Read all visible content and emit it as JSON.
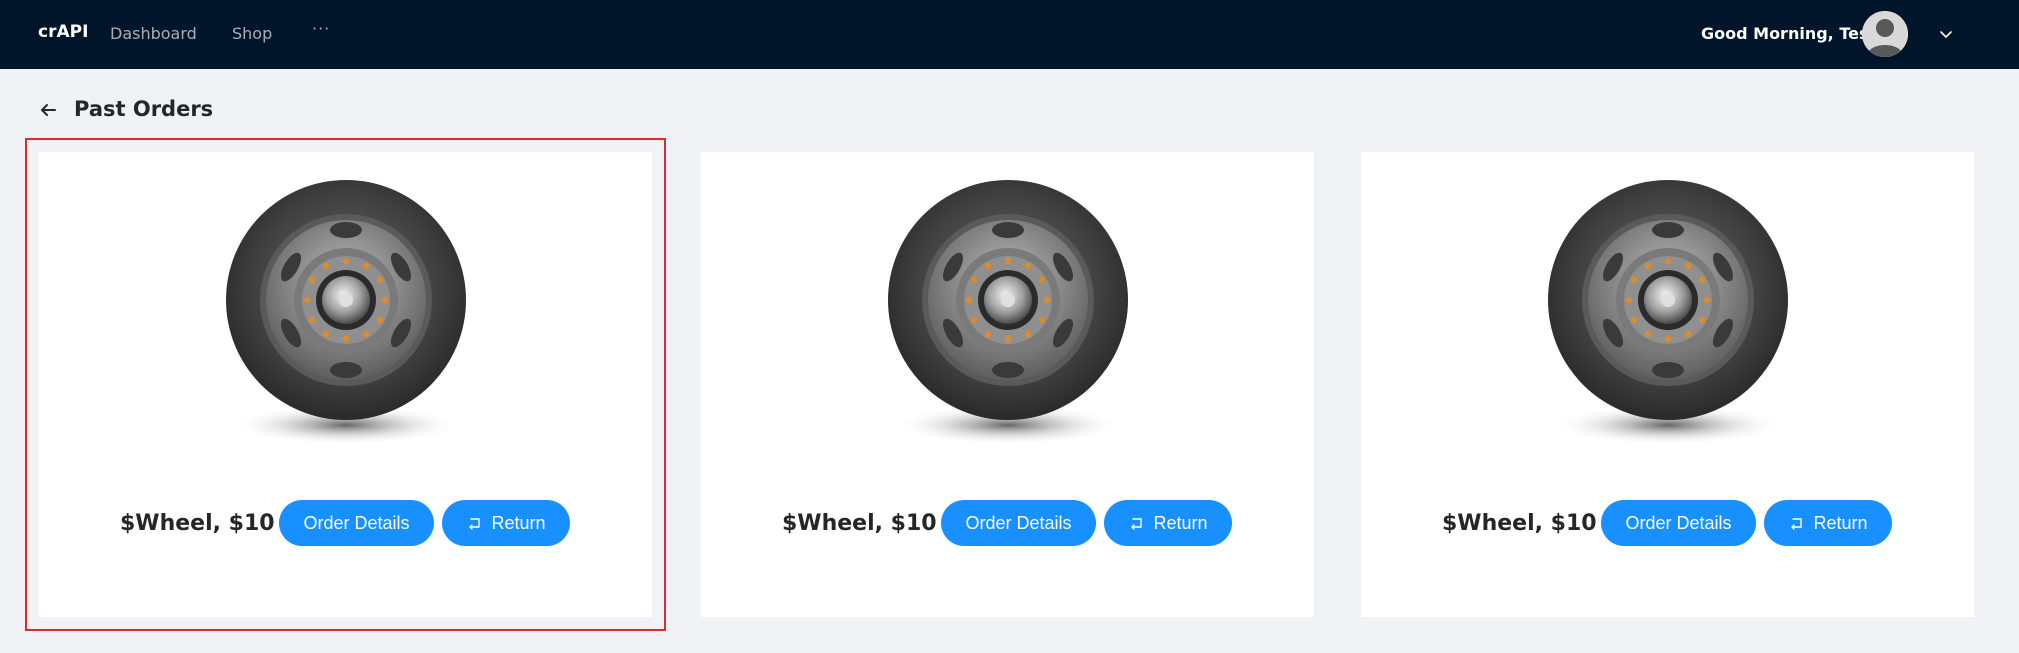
{
  "header": {
    "brand": "crAPI",
    "nav": [
      "Dashboard",
      "Shop"
    ],
    "more": "···",
    "greeting": "Good Morning, Test!"
  },
  "page": {
    "title": "Past Orders"
  },
  "orders": [
    {
      "price_label": "$Wheel, $10",
      "details_label": "Order Details",
      "return_label": "Return"
    },
    {
      "price_label": "$Wheel, $10",
      "details_label": "Order Details",
      "return_label": "Return"
    },
    {
      "price_label": "$Wheel, $10",
      "details_label": "Order Details",
      "return_label": "Return"
    }
  ],
  "colors": {
    "header_bg": "#001529",
    "primary": "#1890ff",
    "page_bg": "#f0f2f5",
    "selection": "#d32f2f"
  },
  "icons": [
    "arrow-left-icon",
    "user-avatar-icon",
    "chevron-down-icon",
    "return-icon",
    "wheel-image"
  ]
}
